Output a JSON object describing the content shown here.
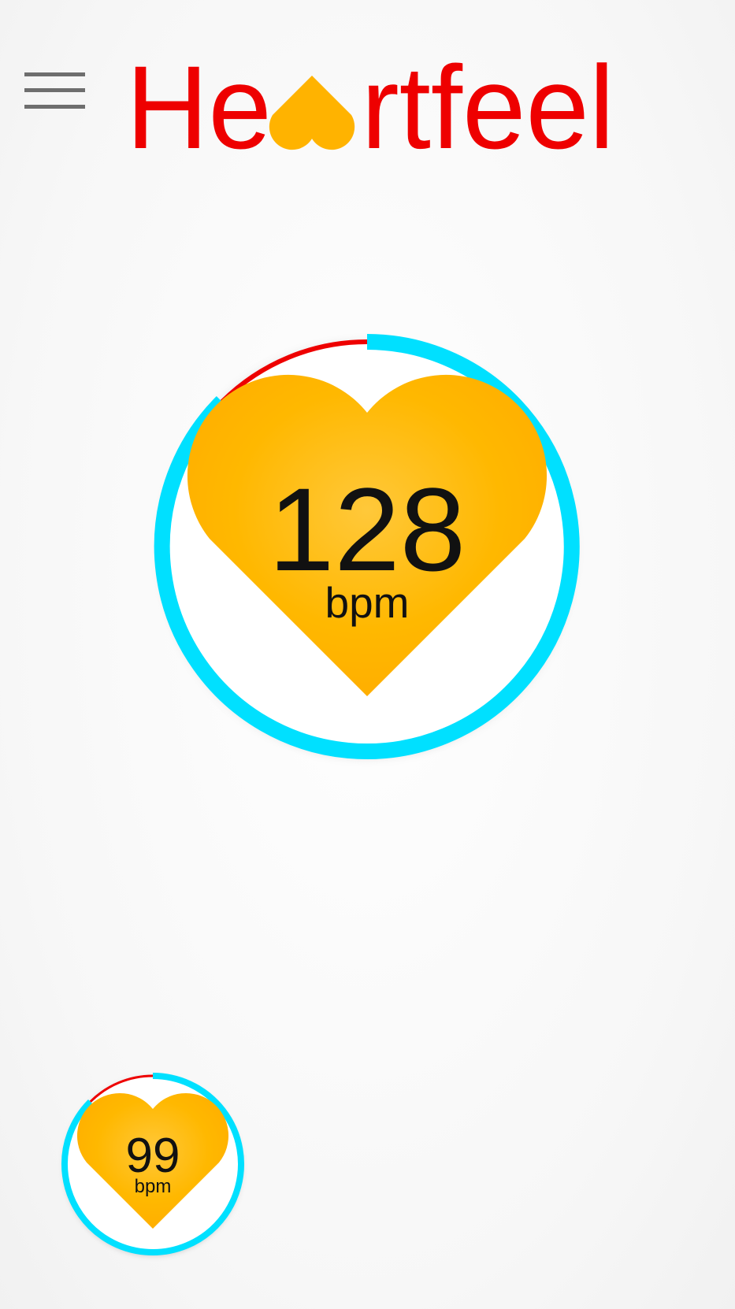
{
  "header": {
    "menu_icon": "hamburger-menu-icon",
    "logo": {
      "text_before": "He",
      "text_after": "rtfeel",
      "heart_icon": "heart-icon",
      "text_color": "#ee0000",
      "heart_color": "#ffb300"
    }
  },
  "main_reading": {
    "value": "128",
    "unit": "bpm",
    "progress_fraction": 0.9,
    "colors": {
      "progress": "#00e0ff",
      "remainder": "#ee0000",
      "heart": "#ffb300"
    }
  },
  "secondary_reading": {
    "value": "99",
    "unit": "bpm",
    "progress_fraction": 0.9,
    "colors": {
      "progress": "#00e0ff",
      "remainder": "#ee0000",
      "heart": "#ffb300"
    }
  }
}
